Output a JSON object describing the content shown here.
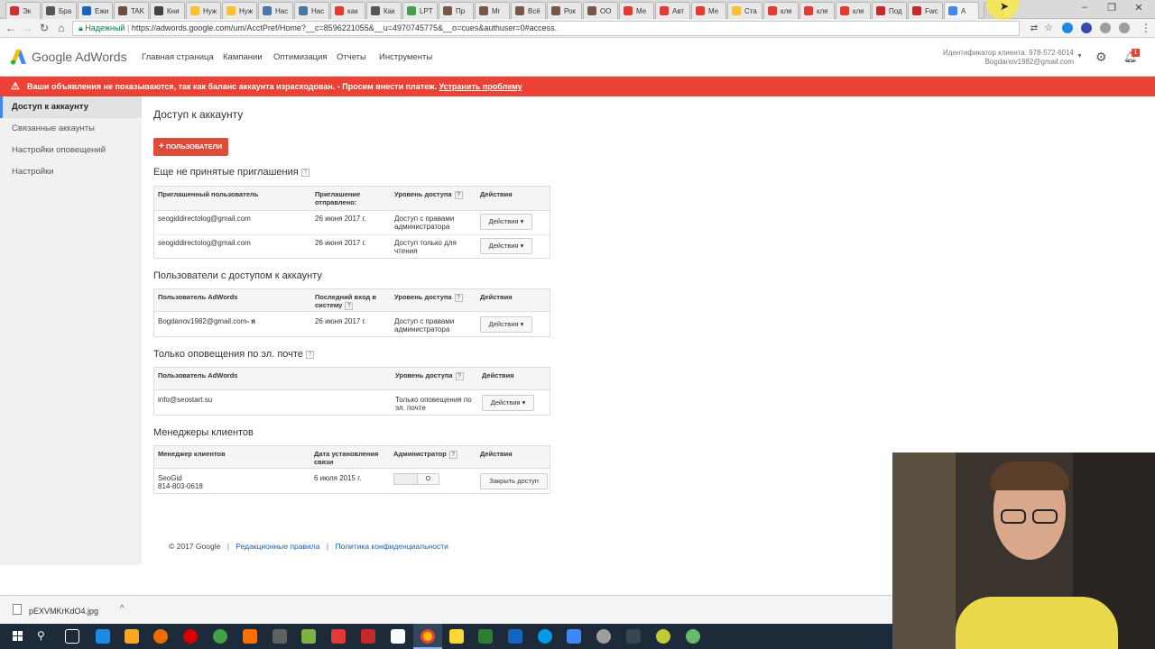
{
  "browser": {
    "tabs": [
      {
        "label": "Эк",
        "color": "#d32f2f"
      },
      {
        "label": "Бра",
        "color": "#555555"
      },
      {
        "label": "Ежи",
        "color": "#1565c0"
      },
      {
        "label": "TAK",
        "color": "#6d4c41"
      },
      {
        "label": "Кни",
        "color": "#424242"
      },
      {
        "label": "Нуж",
        "color": "#fbc02d"
      },
      {
        "label": "Нуж",
        "color": "#fbc02d"
      },
      {
        "label": "Нас",
        "color": "#4a76a8"
      },
      {
        "label": "Нас",
        "color": "#4a76a8"
      },
      {
        "label": "как",
        "color": "#e53935"
      },
      {
        "label": "Как",
        "color": "#555555"
      },
      {
        "label": "LPT",
        "color": "#43a047"
      },
      {
        "label": "Пр",
        "color": "#795548"
      },
      {
        "label": "Мг",
        "color": "#795548"
      },
      {
        "label": "Всё",
        "color": "#795548"
      },
      {
        "label": "Рок",
        "color": "#795548"
      },
      {
        "label": "ОО",
        "color": "#795548"
      },
      {
        "label": "Ме",
        "color": "#e53935"
      },
      {
        "label": "Авт",
        "color": "#e53935"
      },
      {
        "label": "Ме",
        "color": "#e53935"
      },
      {
        "label": "Ста",
        "color": "#fbc02d"
      },
      {
        "label": "кле",
        "color": "#e53935"
      },
      {
        "label": "кле",
        "color": "#e53935"
      },
      {
        "label": "кле",
        "color": "#e53935"
      },
      {
        "label": "Под",
        "color": "#c62828"
      },
      {
        "label": "Fwc",
        "color": "#c62828"
      },
      {
        "label": "A",
        "color": "#4285f4"
      }
    ],
    "url": "https://adwords.google.com/um/AcctPref/Home?__c=8596221055&__u=4970745775&__o=cues&authuser=0#access.",
    "secure_label": "Надежный"
  },
  "header": {
    "logo": "Google AdWords",
    "nav": [
      "Главная страница",
      "Кампании",
      "Оптимизация",
      "Отчеты",
      "Инструменты"
    ],
    "client_id": "Идентификатор клиента: 978-572-6014",
    "client_email": "Bogdanov1982@gmail.com",
    "notif_count": "1"
  },
  "alert": {
    "text": "Ваши объявления не показываются, так как баланс аккаунта израсходован. - Просим внести платеж.",
    "link": "Устранить проблему"
  },
  "sidebar": {
    "items": [
      {
        "label": "Доступ к аккаунту"
      },
      {
        "label": "Связанные аккаунты"
      },
      {
        "label": "Настройки оповещений"
      },
      {
        "label": "Настройки"
      }
    ]
  },
  "main": {
    "title": "Доступ к аккаунту",
    "users_button": "ПОЛЬЗОВАТЕЛИ",
    "pending": {
      "title": "Еще не принятые приглашения",
      "headers": [
        "Приглашенный пользователь",
        "Приглашение отправлено:",
        "Уровень доступа",
        "Действия"
      ],
      "rows": [
        {
          "user": "seogiddirectolog@gmail.com",
          "date": "26 июня 2017 г.",
          "access": "Доступ с правами администратора",
          "action": "Действия"
        },
        {
          "user": "seogiddirectolog@gmail.com",
          "date": "26 июня 2017 г.",
          "access": "Доступ только для чтения",
          "action": "Действия"
        }
      ]
    },
    "users": {
      "title": "Пользователи с доступом к аккаунту",
      "headers": [
        "Пользователь AdWords",
        "Последний вход в систему",
        "Уровень доступа",
        "Действия"
      ],
      "rows": [
        {
          "user": "Bogdanov1982@gmail.com",
          "me": "- я",
          "date": "26 июня 2017 г.",
          "access": "Доступ с правами администратора",
          "action": "Действия"
        }
      ]
    },
    "email_only": {
      "title": "Только оповещения по эл. почте",
      "headers": [
        "Пользователь AdWords",
        "Уровень доступа",
        "Действия"
      ],
      "rows": [
        {
          "user": "info@seostart.su",
          "access": "Только оповещения по эл. почте",
          "action": "Действия"
        }
      ]
    },
    "managers": {
      "title": "Менеджеры клиентов",
      "headers": [
        "Менеджер клиентов",
        "Дата установления связи",
        "Администратор",
        "Действия"
      ],
      "rows": [
        {
          "name": "SeoGid",
          "id": "814-803-0618",
          "date": "6 июля 2015 г.",
          "admin_toggle": "O",
          "action": "Закрыть доступ"
        }
      ]
    },
    "footer": {
      "copyright": "© 2017 Google",
      "links": [
        "Редакционные правила",
        "Политика конфиденциальности"
      ]
    }
  },
  "download": {
    "filename": "pEXVMKrKdO4.jpg"
  },
  "colors": {
    "alert": "#ea4335",
    "button_red": "#dd4b39",
    "accent_blue": "#4285f4"
  }
}
